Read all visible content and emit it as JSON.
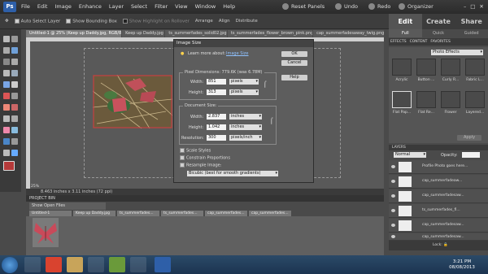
{
  "menubar": {
    "logo": "Ps",
    "menus": [
      "File",
      "Edit",
      "Image",
      "Enhance",
      "Layer",
      "Select",
      "Filter",
      "View",
      "Window",
      "Help"
    ],
    "reset_panels": "Reset Panels",
    "undo": "Undo",
    "redo": "Redo",
    "organizer": "Organizer"
  },
  "right_tabs": [
    "Edit",
    "Create",
    "Share"
  ],
  "sub_tabs": [
    "Full",
    "Quick",
    "Guided"
  ],
  "options_bar": {
    "auto_select": "Auto Select Layer",
    "show_bounding": "Show Bounding Box",
    "show_highlight": "Show Highlight on Rollover",
    "arrange": "Arrange",
    "align": "Align",
    "distribute": "Distribute"
  },
  "doc_tabs": [
    "Untitled-1 @ 25% (Keep up Daddy.jpg, RGB/8)",
    "Keep up Daddy.jpg",
    "ts_summerfades_solid02.jpg",
    "ts_summerfades_flower_brown_pink.png",
    "cap_summerfadesaway_twig.png"
  ],
  "status": "25%",
  "status_size": "8.463 inches x 3.11 inches (72 ppi)",
  "project_bin": {
    "header": "PROJECT BIN",
    "select": "Show Open Files",
    "files": [
      "Untitled-1",
      "Keep up Daddy.jpg",
      "ts_summerfades...",
      "ts_summerfades...",
      "cap_summerfades...",
      "cap_summerfades..."
    ]
  },
  "dialog": {
    "title": "Image Size",
    "learn": "Learn more about:",
    "learn_link": "Image Size",
    "ok": "OK",
    "cancel": "Cancel",
    "help": "Help",
    "pixel_dim": "Pixel Dimensions: 779.6K (was 6.78M)",
    "width_label": "Width:",
    "width_val": "851",
    "width_unit": "pixels",
    "height_label": "Height:",
    "height_val": "313",
    "height_unit": "pixels",
    "doc_size": "Document Size:",
    "doc_width_val": "2.837",
    "doc_width_unit": "inches",
    "doc_height_val": "1.042",
    "doc_height_unit": "inches",
    "resolution_label": "Resolution:",
    "resolution_val": "300",
    "resolution_unit": "pixels/inch",
    "scale_styles": "Scale Styles",
    "constrain": "Constrain Proportions",
    "resample": "Resample Image:",
    "resample_method": "Bicubic (best for smooth gradients)"
  },
  "effects": {
    "tabs": [
      "EFFECTS",
      "CONTENT",
      "FAVORITES"
    ],
    "selector": "Photo Effects",
    "items": [
      "Acrylic",
      "Button ...",
      "Curly R...",
      "Fabric L...",
      "Flat Pap...",
      "Flat Re...",
      "Flower",
      "Layered..."
    ],
    "apply": "Apply"
  },
  "layers": {
    "header": "LAYERS",
    "blend": "Normal",
    "opacity_label": "Opacity:",
    "items": [
      "Profile Photo goes here...",
      "cap_summerfadeaw...",
      "cap_summerfadesaw...",
      "ts_summerfades_fl...",
      "cap_summerfadesaw...",
      "cap_summerfadesaw..."
    ],
    "lock": "Lock:"
  },
  "clock": {
    "time": "3:21 PM",
    "date": "08/08/2013"
  },
  "colors": {
    "accent": "#2e5fa8",
    "foreground": "#b53a3a",
    "background": "#ffffff"
  }
}
